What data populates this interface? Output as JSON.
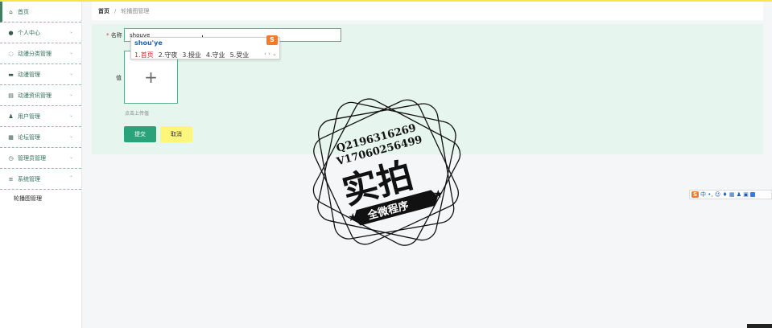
{
  "sidebar": {
    "items": [
      {
        "label": "首页",
        "icon": "home-icon",
        "has_chevron": false
      },
      {
        "label": "个人中心",
        "icon": "user-icon",
        "has_chevron": true
      },
      {
        "label": "动漫分类管理",
        "icon": "category-icon",
        "has_chevron": true
      },
      {
        "label": "动漫管理",
        "icon": "monitor-icon",
        "has_chevron": true
      },
      {
        "label": "动漫资讯管理",
        "icon": "news-icon",
        "has_chevron": true
      },
      {
        "label": "用户管理",
        "icon": "person-icon",
        "has_chevron": true
      },
      {
        "label": "论坛管理",
        "icon": "forum-icon",
        "has_chevron": true
      },
      {
        "label": "管理员管理",
        "icon": "admin-icon",
        "has_chevron": true
      },
      {
        "label": "系统管理",
        "icon": "menu-icon",
        "has_chevron": true
      }
    ],
    "sub_item": "轮播图管理"
  },
  "breadcrumb": {
    "home": "首页",
    "separator": "/",
    "current": "轮播图管理"
  },
  "form": {
    "name_label": "名称",
    "name_required": "*",
    "name_value": "shouye",
    "value_label": "值",
    "upload_plus": "+",
    "upload_tip": "点击上传值",
    "submit_label": "提交",
    "cancel_label": "取消"
  },
  "ime": {
    "pinyin": "shou'ye",
    "candidates": [
      "1.首页",
      "2.守夜",
      "3.授业",
      "4.守业",
      "5.受业"
    ],
    "logo": "S",
    "nav": "‹ › ⌄"
  },
  "stamp": {
    "line1": "Q2196316269",
    "line2": "V17060256499",
    "big": "实拍",
    "banner": "全微程序"
  },
  "ime_toolbar": {
    "logo": "S",
    "text": "中 •, ☺ ♦ ▦ ♟ ▣"
  },
  "colors": {
    "accent": "#2aa37b",
    "panel": "#e6f5ee",
    "cancel": "#fdf67a",
    "topbar": "#f3e84a"
  }
}
